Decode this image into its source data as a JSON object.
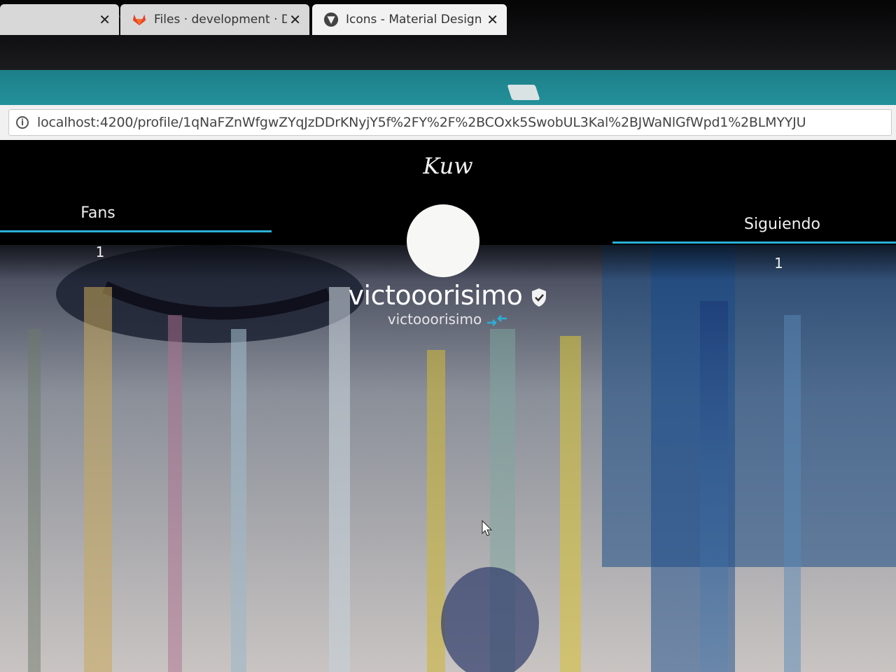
{
  "browser": {
    "tabs": [
      {
        "title": "",
        "close": "✕"
      },
      {
        "title": "Files · development · Die",
        "close": "✕"
      },
      {
        "title": "Icons - Material Design",
        "close": "✕"
      }
    ],
    "address": {
      "url": "localhost:4200/profile/1qNaFZnWfgwZYqJzDDrKNyjY5f%2FY%2F%2BCOxk5SwobUL3Kal%2BJWaNlGfWpd1%2BLMYYJU"
    }
  },
  "app": {
    "logo": "Kuw"
  },
  "profile": {
    "fans": {
      "label": "Fans",
      "count": "1"
    },
    "following": {
      "label": "Siguiendo",
      "count": "1"
    },
    "display_name": "victooorisimo",
    "username": "victooorisimo"
  },
  "colors": {
    "accent": "#2ab0d8",
    "tabstrip": "#1f8790",
    "page_bg": "#000000"
  },
  "icons": {
    "verified": "verified-shield-icon",
    "swap": "swap-arrows-icon",
    "info": "info-icon"
  }
}
